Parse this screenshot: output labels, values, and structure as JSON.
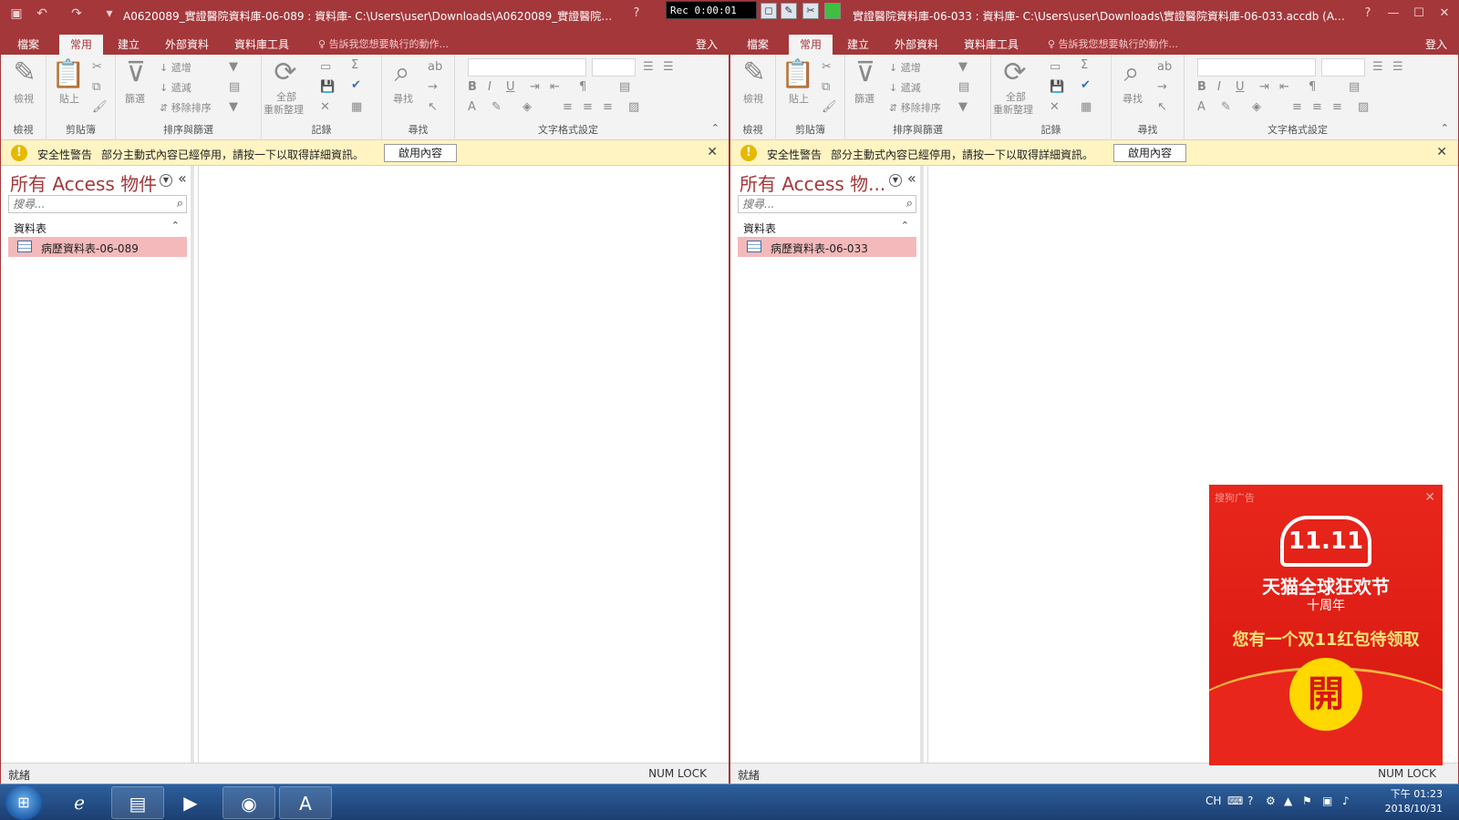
{
  "recorder": {
    "time": "Rec 0:00:01"
  },
  "left_window": {
    "title": "A0620089_實證醫院資料庫-06-089 : 資料庫- C:\\Users\\user\\Downloads\\A0620089_實證醫院資料...",
    "help": "?",
    "tabs": [
      "檔案",
      "常用",
      "建立",
      "外部資料",
      "資料庫工具"
    ],
    "tell_me": "告訴我您想要執行的動作...",
    "signin": "登入",
    "nav_title": "所有 Access 物件",
    "nav_item": "病歷資料表-06-089"
  },
  "right_window": {
    "title": "實證醫院資料庫-06-033 : 資料庫- C:\\Users\\user\\Downloads\\實證醫院資料庫-06-033.accdb (Acc...",
    "help": "?",
    "tabs": [
      "檔案",
      "常用",
      "建立",
      "外部資料",
      "資料庫工具"
    ],
    "tell_me": "告訴我您想要執行的動作...",
    "signin": "登入",
    "nav_title": "所有 Access 物...",
    "nav_item": "病歷資料表-06-033"
  },
  "ribbon": {
    "view_label": "檢視",
    "view_group": "檢視",
    "paste_label": "貼上",
    "clipboard_group": "剪貼簿",
    "filter_label": "篩選",
    "ascending": "遞增",
    "descending": "遞減",
    "remove_sort": "移除排序",
    "sort_filter_group": "排序與篩選",
    "refresh_all_1": "全部",
    "refresh_all_2": "重新整理",
    "records_group": "記錄",
    "find_label": "尋找",
    "find_group": "尋找",
    "text_format_group": "文字格式設定"
  },
  "security_bar": {
    "title": "安全性警告",
    "message": "部分主動式內容已經停用，請按一下以取得詳細資訊。",
    "button": "啟用內容"
  },
  "nav": {
    "search_placeholder": "搜尋...",
    "section": "資料表"
  },
  "status": {
    "left": "就緒",
    "right": "NUM LOCK"
  },
  "ad": {
    "label": "搜狗广告",
    "logo": "11.11",
    "headline": "天猫全球狂欢节",
    "sub": "十周年",
    "promo": "您有一个双11红包待领取",
    "coin": "開"
  },
  "taskbar": {
    "lang": "CH",
    "time": "下午 01:23",
    "date": "2018/10/31"
  }
}
